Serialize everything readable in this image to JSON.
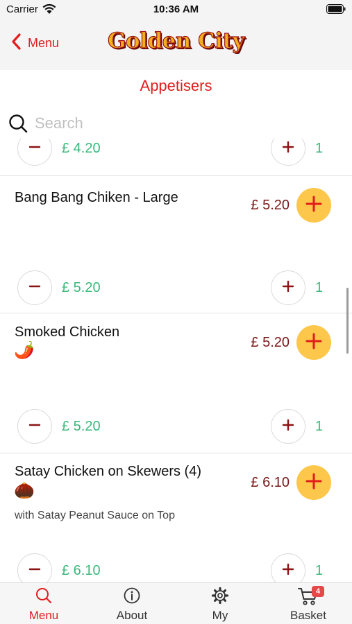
{
  "status_bar": {
    "carrier": "Carrier",
    "time": "10:36 AM"
  },
  "nav": {
    "back_label": "Menu",
    "brand": "Golden City"
  },
  "section_title": "Appetisers",
  "search": {
    "placeholder": "Search",
    "value": ""
  },
  "items": [
    {
      "name": "",
      "emoji": "",
      "description": "",
      "price": "",
      "line_total": "£ 4.20",
      "quantity": "1"
    },
    {
      "name": "Bang Bang Chiken - Large",
      "emoji": "",
      "description": "",
      "price": "£ 5.20",
      "line_total": "£ 5.20",
      "quantity": "1"
    },
    {
      "name": "Smoked Chicken",
      "emoji": "🌶️",
      "emoji_meaning": "chili-pepper",
      "description": "",
      "price": "£ 5.20",
      "line_total": "£ 5.20",
      "quantity": "1"
    },
    {
      "name": "Satay Chicken on Skewers (4)",
      "emoji": "🌰",
      "emoji_meaning": "nut",
      "description": "with Satay Peanut Sauce on Top",
      "price": "£ 6.10",
      "line_total": "£ 6.10",
      "quantity": "1"
    }
  ],
  "tabs": [
    {
      "label": "Menu",
      "icon": "search-icon",
      "active": true
    },
    {
      "label": "About",
      "icon": "info-icon",
      "active": false
    },
    {
      "label": "My",
      "icon": "gear-icon",
      "active": false
    },
    {
      "label": "Basket",
      "icon": "cart-icon",
      "active": false,
      "badge": "4"
    }
  ],
  "colors": {
    "accent_red": "#e11d1d",
    "price_maroon": "#7a1818",
    "total_green": "#3ab87a",
    "add_button_yellow": "#fdc74c",
    "badge_red": "#e44848"
  }
}
